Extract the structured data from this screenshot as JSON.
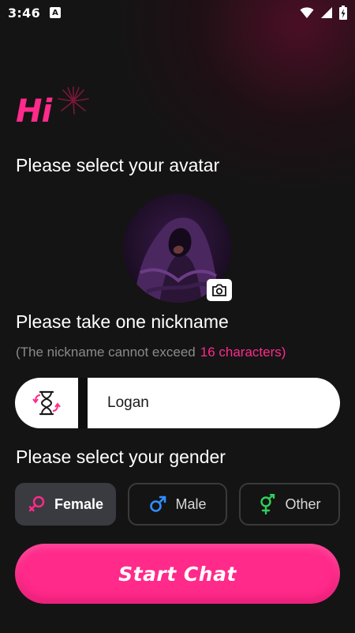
{
  "status_bar": {
    "time": "3:46",
    "badge": "A",
    "icons": [
      "wifi-icon",
      "signal-icon",
      "battery-icon"
    ]
  },
  "logo": {
    "text": "Hi"
  },
  "avatar_section": {
    "title": "Please select your avatar",
    "camera_icon": "camera-icon"
  },
  "nickname_section": {
    "title": "Please take one nickname",
    "hint_prefix": "(The nickname cannot exceed",
    "hint_limit": "16 characters)",
    "value": "Logan",
    "shuffle_icon": "hourglass-shuffle-icon"
  },
  "gender_section": {
    "title": "Please select your gender",
    "options": [
      {
        "label": "Female",
        "icon": "female-icon",
        "color": "#ff2a8a",
        "selected": true
      },
      {
        "label": "Male",
        "icon": "male-icon",
        "color": "#2f8fff",
        "selected": false
      },
      {
        "label": "Other",
        "icon": "other-gender-icon",
        "color": "#2fcf5a",
        "selected": false
      }
    ]
  },
  "start_button": {
    "label": "Start Chat"
  },
  "colors": {
    "accent": "#ff2a8a",
    "background": "#141414"
  }
}
